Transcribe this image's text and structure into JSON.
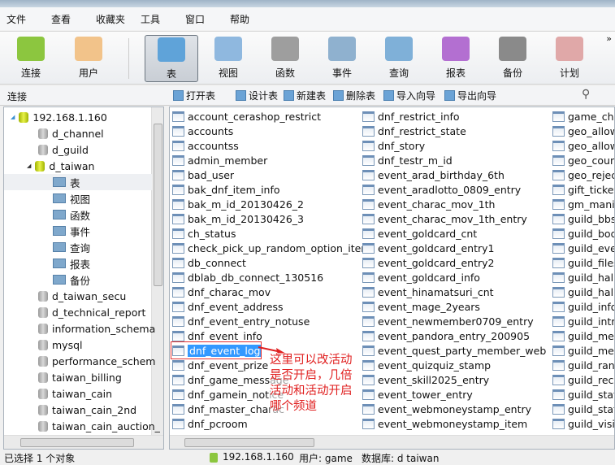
{
  "menu": [
    "文件",
    "查看",
    "收藏夹",
    "工具",
    "窗口",
    "帮助"
  ],
  "toolbar": [
    {
      "label": "连接",
      "icon": "connection-icon",
      "color": "#8cc63f"
    },
    {
      "label": "用户",
      "icon": "user-icon",
      "color": "#f2c38a"
    },
    {
      "label": "表",
      "icon": "table-icon",
      "color": "#5fa3d9",
      "active": true
    },
    {
      "label": "视图",
      "icon": "view-icon",
      "color": "#8fb8df"
    },
    {
      "label": "函数",
      "icon": "function-icon",
      "color": "#9e9e9e"
    },
    {
      "label": "事件",
      "icon": "event-icon",
      "color": "#8fb1cf"
    },
    {
      "label": "查询",
      "icon": "query-icon",
      "color": "#7fb0d8"
    },
    {
      "label": "报表",
      "icon": "report-icon",
      "color": "#b36fd1"
    },
    {
      "label": "备份",
      "icon": "backup-icon",
      "color": "#8a8a8a"
    },
    {
      "label": "计划",
      "icon": "schedule-icon",
      "color": "#e0a8a8"
    }
  ],
  "subbar": {
    "label": "连接",
    "buttons": [
      "打开表",
      "设计表",
      "新建表",
      "删除表",
      "导入向导",
      "导出向导"
    ]
  },
  "tree": {
    "server": "192.168.1.160",
    "dbs_before": [
      "d_channel",
      "d_guild"
    ],
    "open_db": "d_taiwan",
    "children": [
      "表",
      "视图",
      "函数",
      "事件",
      "查询",
      "报表",
      "备份"
    ],
    "dbs_after": [
      "d_taiwan_secu",
      "d_technical_report",
      "information_schema",
      "mysql",
      "performance_schem",
      "taiwan_billing",
      "taiwan_cain",
      "taiwan_cain_2nd",
      "taiwan_cain_auction_"
    ]
  },
  "tables": {
    "col1": [
      "account_cerashop_restrict",
      "accounts",
      "accountss",
      "admin_member",
      "bad_user",
      "bak_dnf_item_info",
      "bak_m_id_20130426_2",
      "bak_m_id_20130426_3",
      "ch_status",
      "check_pick_up_random_option_item",
      "db_connect",
      "dblab_db_connect_130516",
      "dnf_charac_mov",
      "dnf_event_address",
      "dnf_event_entry_notuse",
      "dnf_event_info",
      "dnf_event_log",
      "dnf_event_prize",
      "dnf_game_message",
      "dnf_gamein_notice",
      "dnf_master_charac",
      "dnf_pcroom"
    ],
    "col2": [
      "dnf_restrict_info",
      "dnf_restrict_state",
      "dnf_story",
      "dnf_testr_m_id",
      "event_arad_birthday_6th",
      "event_aradlotto_0809_entry",
      "event_charac_mov_1th",
      "event_charac_mov_1th_entry",
      "event_goldcard_cnt",
      "event_goldcard_entry1",
      "event_goldcard_entry2",
      "event_goldcard_info",
      "event_hinamatsuri_cnt",
      "event_mage_2years",
      "event_newmember0709_entry",
      "event_pandora_entry_200905",
      "event_quest_party_member_web",
      "event_quizquiz_stamp",
      "event_skill2025_entry",
      "event_tower_entry",
      "event_webmoneystamp_entry",
      "event_webmoneystamp_item"
    ],
    "col3": [
      "game_char",
      "geo_allow",
      "geo_allow_",
      "geo_count",
      "geo_reject",
      "gift_ticket_",
      "gm_manife",
      "guild_bbs",
      "guild_body",
      "guild_even",
      "guild_files",
      "guild_hallc",
      "guild_hallc",
      "guild_info",
      "guild_intro",
      "guild_mem",
      "guild_mem",
      "guild_rank",
      "guild_reco",
      "guild_stat",
      "guild_stat_",
      "guild_visit"
    ],
    "selected": "dnf_event_log"
  },
  "annotation": "这里可以改活动是否开启，几倍活动和活动开启哪个频道",
  "status": {
    "left": "已选择 1 个对象",
    "server": "192.168.1.160",
    "user": "用户: game",
    "db": "数据库: d taiwan"
  }
}
